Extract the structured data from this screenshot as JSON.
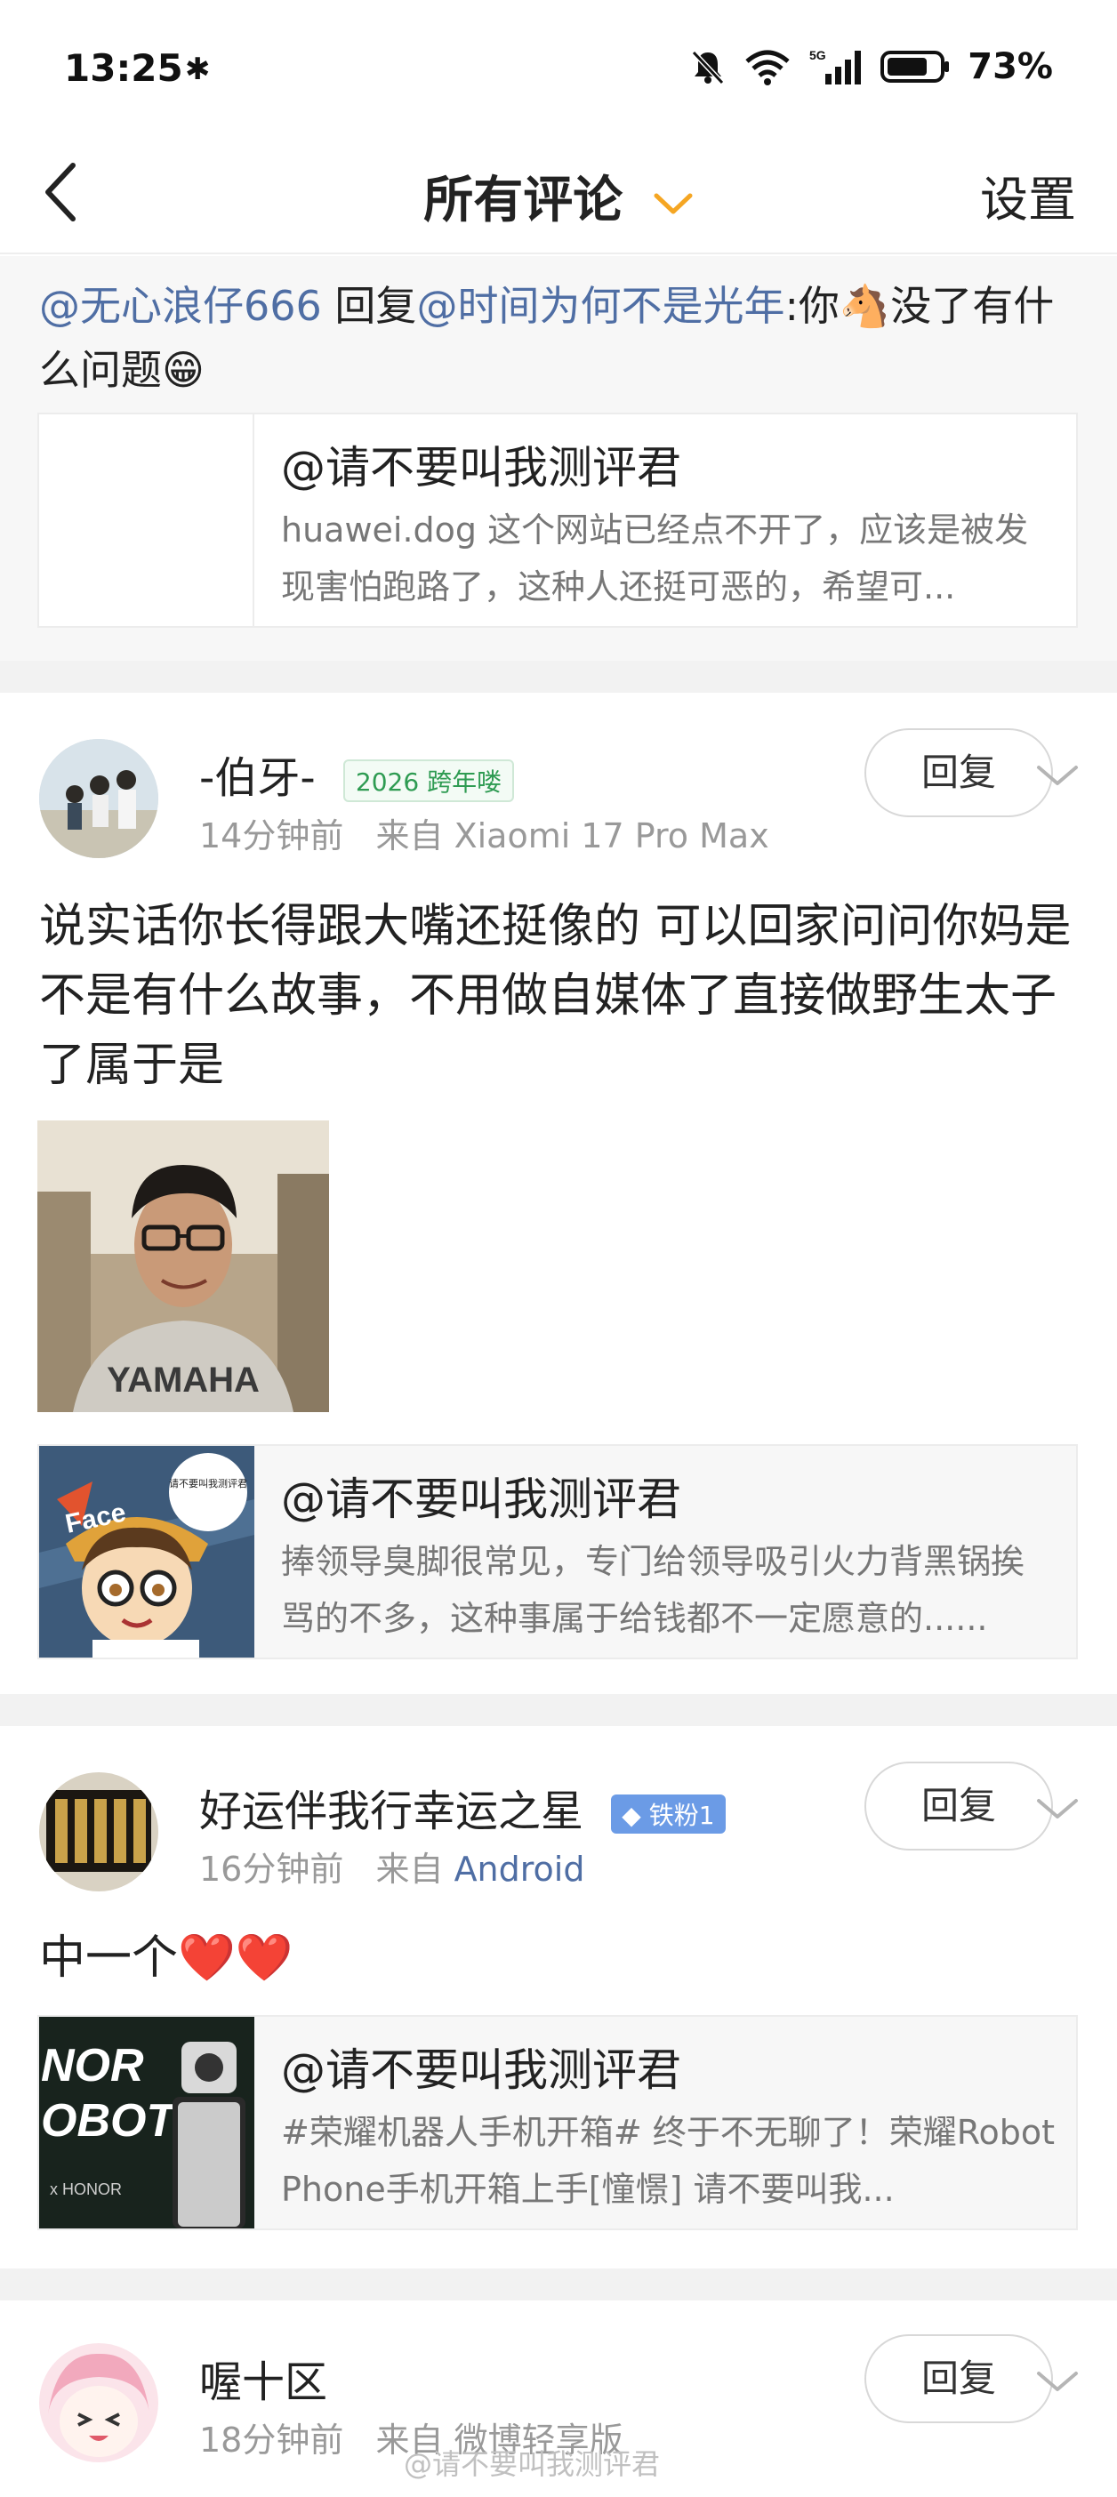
{
  "status_bar": {
    "time": "13:25",
    "battery": "73%",
    "network": "5G"
  },
  "nav": {
    "title": "所有评论",
    "settings": "设置"
  },
  "reply_block": {
    "user": "@无心浪仔666",
    "reply_word": " 回复",
    "target": "@时间为何不是光年",
    "text": ":你🐴没了有什么问题😁",
    "card_title": "@请不要叫我测评君",
    "card_desc": "huawei.dog 这个网站已经点不开了，应该是被发现害怕跑路了，这种人还挺可恶的，希望可..."
  },
  "comments": [
    {
      "username": "-伯牙-",
      "badge": "2026 跨年喽",
      "time": "14分钟前",
      "source_prefix": "来自",
      "source": "Xiaomi 17 Pro Max",
      "reply_label": "回复",
      "content": "说实话你长得跟大嘴还挺像的 可以回家问问你妈是不是有什么故事，不用做自媒体了直接做野生太子了属于是",
      "photo_text": "YAMAHA",
      "card_thumb_text": "请不要叫我测评君",
      "card_title": "@请不要叫我测评君",
      "card_desc": "捧领导臭脚很常见，专门给领导吸引火力背黑锅挨骂的不多，这种事属于给钱都不一定愿意的......"
    },
    {
      "username": "好运伴我行幸运之星",
      "badge": "铁粉1",
      "time": "16分钟前",
      "source_prefix": "来自",
      "source": "Android",
      "reply_label": "回复",
      "content": "中一个❤️❤️",
      "card_thumb_text": "NOR OBOT",
      "card_thumb_sub": "x HONOR",
      "card_title": "@请不要叫我测评君",
      "card_desc": "#荣耀机器人手机开箱# 终于不无聊了！荣耀Robot Phone手机开箱上手[憧憬] 请不要叫我..."
    },
    {
      "username": "喔十区",
      "time": "18分钟前",
      "source_prefix": "来自",
      "source": "微博轻享版",
      "reply_label": "回复"
    }
  ],
  "watermark": "@请不要叫我测评君",
  "colors": {
    "link_blue": "#4f6ea4",
    "accent_orange": "#f5a623",
    "badge_green": "#2e9b52",
    "badge_blue": "#6b9be6"
  },
  "icons": [
    "back-icon",
    "chevron-down-icon",
    "bluetooth-icon",
    "mute-icon",
    "wifi-icon",
    "signal-icon",
    "battery-icon"
  ]
}
